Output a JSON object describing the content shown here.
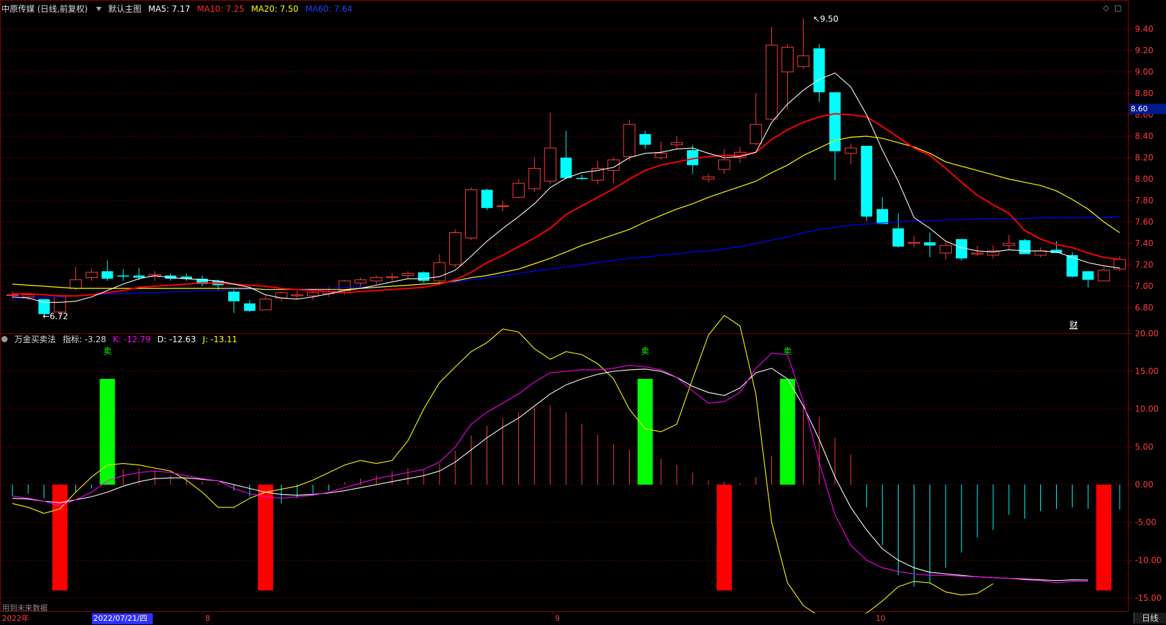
{
  "main_header": {
    "title": "中原传媒 (日线,前复权)",
    "indicator": "默认主图",
    "ma5": "MA5: 7.17",
    "ma10": "MA10: 7.25",
    "ma20": "MA20: 7.50",
    "ma60": "MA60: 7.64"
  },
  "sub_header": {
    "title": "万金买卖法",
    "indicator": "指标: -3.28",
    "k": "K: -12.79",
    "d": "D: -12.63",
    "j": "J: -13.11"
  },
  "annotations": {
    "high": "9.50",
    "low": "6.72",
    "cai": "财",
    "sell": "卖",
    "current_price": "8.60",
    "future_data": "用到未来数据"
  },
  "date_axis": {
    "year": "2022年",
    "cursor_date": "2022/07/21/四",
    "months": [
      "8",
      "9",
      "10"
    ],
    "period": "日线"
  },
  "colors": {
    "up": "#ff3b3b",
    "down": "#00ffff",
    "ma5": "#ffffff",
    "ma10": "#ff0000",
    "ma20": "#ffff00",
    "ma60": "#0000ff",
    "k": "#ff00ff",
    "d": "#ffffff",
    "j": "#ffff00",
    "buy": "#ff0000",
    "sell": "#00ff00"
  },
  "chart_data": [
    {
      "type": "candlestick",
      "title": "中原传媒 (日线,前复权)",
      "ylim": [
        6.6,
        9.5
      ],
      "y_ticks": [
        "9.40",
        "9.20",
        "9.00",
        "8.80",
        "8.60",
        "8.40",
        "8.20",
        "8.00",
        "7.80",
        "7.60",
        "7.40",
        "7.20",
        "7.00",
        "6.80"
      ],
      "candles": [
        [
          6.92,
          6.95,
          6.88,
          6.92
        ],
        [
          6.9,
          6.94,
          6.87,
          6.92
        ],
        [
          6.88,
          6.88,
          6.72,
          6.74
        ],
        [
          6.76,
          6.92,
          6.72,
          6.9
        ],
        [
          6.98,
          7.18,
          6.96,
          7.06
        ],
        [
          7.08,
          7.16,
          7.05,
          7.13
        ],
        [
          7.14,
          7.24,
          7.05,
          7.07
        ],
        [
          7.1,
          7.16,
          7.05,
          7.09
        ],
        [
          7.1,
          7.17,
          7.06,
          7.08
        ],
        [
          7.09,
          7.14,
          7.05,
          7.11
        ],
        [
          7.1,
          7.12,
          7.05,
          7.07
        ],
        [
          7.09,
          7.12,
          7.05,
          7.07
        ],
        [
          7.07,
          7.1,
          7.0,
          7.02
        ],
        [
          7.05,
          7.06,
          6.96,
          7.01
        ],
        [
          6.95,
          6.97,
          6.75,
          6.86
        ],
        [
          6.84,
          6.87,
          6.76,
          6.77
        ],
        [
          6.78,
          6.92,
          6.78,
          6.88
        ],
        [
          6.89,
          6.95,
          6.86,
          6.94
        ],
        [
          6.91,
          6.96,
          6.88,
          6.92
        ],
        [
          6.91,
          6.96,
          6.87,
          6.94
        ],
        [
          6.93,
          6.99,
          6.9,
          6.95
        ],
        [
          6.96,
          7.06,
          6.92,
          7.05
        ],
        [
          7.03,
          7.08,
          7.0,
          7.06
        ],
        [
          7.05,
          7.1,
          7.02,
          7.08
        ],
        [
          7.08,
          7.12,
          7.05,
          7.09
        ],
        [
          7.1,
          7.14,
          7.07,
          7.12
        ],
        [
          7.13,
          7.14,
          7.03,
          7.05
        ],
        [
          7.05,
          7.3,
          7.03,
          7.22
        ],
        [
          7.2,
          7.53,
          7.18,
          7.5
        ],
        [
          7.45,
          7.92,
          7.43,
          7.9
        ],
        [
          7.9,
          7.91,
          7.71,
          7.73
        ],
        [
          7.75,
          7.8,
          7.7,
          7.75
        ],
        [
          7.83,
          8.0,
          7.82,
          7.96
        ],
        [
          7.91,
          8.2,
          7.88,
          8.1
        ],
        [
          7.98,
          8.62,
          7.95,
          8.29
        ],
        [
          8.2,
          8.45,
          8.0,
          8.01
        ],
        [
          8.01,
          8.04,
          7.99,
          8.0
        ],
        [
          7.99,
          8.17,
          7.95,
          8.1
        ],
        [
          8.08,
          8.2,
          7.96,
          8.18
        ],
        [
          8.21,
          8.55,
          8.17,
          8.51
        ],
        [
          8.42,
          8.45,
          8.28,
          8.32
        ],
        [
          8.2,
          8.35,
          8.18,
          8.24
        ],
        [
          8.32,
          8.4,
          8.28,
          8.34
        ],
        [
          8.27,
          8.32,
          8.05,
          8.13
        ],
        [
          8.0,
          8.05,
          7.97,
          8.02
        ],
        [
          8.09,
          8.28,
          8.05,
          8.18
        ],
        [
          8.2,
          8.3,
          8.15,
          8.25
        ],
        [
          8.33,
          8.8,
          8.32,
          8.51
        ],
        [
          8.56,
          9.42,
          8.55,
          9.25
        ],
        [
          9.0,
          9.26,
          8.65,
          9.23
        ],
        [
          9.05,
          9.5,
          9.03,
          9.15
        ],
        [
          9.22,
          9.26,
          8.72,
          8.81
        ],
        [
          8.81,
          8.81,
          7.99,
          8.26
        ],
        [
          8.24,
          8.33,
          8.14,
          8.29
        ],
        [
          8.31,
          8.31,
          7.61,
          7.65
        ],
        [
          7.72,
          7.83,
          7.58,
          7.58
        ],
        [
          7.54,
          7.68,
          7.36,
          7.37
        ],
        [
          7.4,
          7.47,
          7.36,
          7.41
        ],
        [
          7.41,
          7.5,
          7.27,
          7.38
        ],
        [
          7.31,
          7.42,
          7.25,
          7.38
        ],
        [
          7.44,
          7.44,
          7.24,
          7.26
        ],
        [
          7.3,
          7.38,
          7.28,
          7.31
        ],
        [
          7.29,
          7.38,
          7.26,
          7.33
        ],
        [
          7.38,
          7.48,
          7.34,
          7.4
        ],
        [
          7.43,
          7.44,
          7.3,
          7.3
        ],
        [
          7.29,
          7.36,
          7.27,
          7.33
        ],
        [
          7.34,
          7.42,
          7.31,
          7.31
        ],
        [
          7.29,
          7.32,
          7.08,
          7.09
        ],
        [
          7.14,
          7.14,
          6.99,
          7.06
        ],
        [
          7.05,
          7.18,
          7.05,
          7.15
        ],
        [
          7.16,
          7.28,
          7.14,
          7.25
        ]
      ],
      "ma5": [
        6.9,
        6.89,
        6.85,
        6.85,
        6.86,
        6.9,
        6.96,
        7.02,
        7.07,
        7.1,
        7.08,
        7.07,
        7.06,
        7.05,
        7.02,
        6.99,
        6.92,
        6.89,
        6.88,
        6.9,
        6.93,
        6.96,
        6.98,
        7.01,
        7.04,
        7.07,
        7.07,
        7.09,
        7.15,
        7.28,
        7.42,
        7.54,
        7.65,
        7.77,
        7.92,
        8.01,
        8.06,
        8.08,
        8.11,
        8.2,
        8.24,
        8.25,
        8.28,
        8.29,
        8.24,
        8.2,
        8.21,
        8.25,
        8.53,
        8.7,
        8.83,
        8.93,
        8.99,
        8.86,
        8.6,
        8.27,
        7.98,
        7.64,
        7.54,
        7.42,
        7.36,
        7.33,
        7.32,
        7.34,
        7.33,
        7.33,
        7.32,
        7.27,
        7.22,
        7.19,
        7.17
      ],
      "ma10": [
        6.93,
        6.93,
        6.92,
        6.91,
        6.91,
        6.92,
        6.94,
        6.96,
        6.99,
        7.0,
        7.01,
        7.02,
        7.03,
        7.03,
        7.02,
        7.01,
        7.0,
        6.98,
        6.97,
        6.96,
        6.95,
        6.94,
        6.95,
        6.96,
        6.97,
        6.98,
        6.99,
        7.02,
        7.06,
        7.13,
        7.22,
        7.29,
        7.37,
        7.45,
        7.54,
        7.67,
        7.75,
        7.83,
        7.91,
        8.0,
        8.08,
        8.13,
        8.16,
        8.19,
        8.21,
        8.22,
        8.22,
        8.25,
        8.37,
        8.46,
        8.53,
        8.58,
        8.61,
        8.6,
        8.58,
        8.49,
        8.39,
        8.29,
        8.22,
        8.1,
        7.97,
        7.85,
        7.76,
        7.68,
        7.52,
        7.44,
        7.39,
        7.36,
        7.31,
        7.27,
        7.25
      ],
      "ma20": [
        7.02,
        7.01,
        7.0,
        6.99,
        6.98,
        6.98,
        6.98,
        6.98,
        6.98,
        6.98,
        6.98,
        6.98,
        6.98,
        6.98,
        6.98,
        6.98,
        6.97,
        6.97,
        6.97,
        6.97,
        6.97,
        6.97,
        6.98,
        6.99,
        7.0,
        7.01,
        7.02,
        7.03,
        7.05,
        7.08,
        7.1,
        7.13,
        7.16,
        7.21,
        7.26,
        7.32,
        7.38,
        7.43,
        7.48,
        7.53,
        7.6,
        7.66,
        7.72,
        7.77,
        7.83,
        7.88,
        7.93,
        7.98,
        8.06,
        8.13,
        8.22,
        8.29,
        8.36,
        8.39,
        8.4,
        8.38,
        8.34,
        8.3,
        8.24,
        8.16,
        8.12,
        8.08,
        8.04,
        8.0,
        7.97,
        7.94,
        7.89,
        7.81,
        7.72,
        7.6,
        7.5
      ],
      "ma60": [
        6.89,
        6.89,
        6.9,
        6.9,
        6.91,
        6.92,
        6.93,
        6.93,
        6.94,
        6.94,
        6.95,
        6.95,
        6.96,
        6.96,
        6.97,
        6.97,
        6.97,
        6.97,
        6.97,
        6.98,
        6.98,
        6.99,
        6.99,
        7.0,
        7.0,
        7.01,
        7.02,
        7.03,
        7.04,
        7.06,
        7.08,
        7.1,
        7.12,
        7.14,
        7.16,
        7.18,
        7.2,
        7.22,
        7.24,
        7.26,
        7.27,
        7.29,
        7.3,
        7.32,
        7.33,
        7.35,
        7.37,
        7.4,
        7.43,
        7.46,
        7.5,
        7.53,
        7.55,
        7.57,
        7.58,
        7.59,
        7.6,
        7.61,
        7.61,
        7.62,
        7.62,
        7.63,
        7.63,
        7.63,
        7.63,
        7.64,
        7.64,
        7.64,
        7.64,
        7.64,
        7.65
      ]
    },
    {
      "type": "bar+line",
      "title": "万金买卖法",
      "ylim": [
        -18,
        24
      ],
      "y_ticks": [
        "20.00",
        "15.00",
        "10.00",
        "5.00",
        "0.00",
        "-5.00",
        "-10.00",
        "-15.00"
      ],
      "indicator_hist": [
        -1.5,
        -1.2,
        -1.8,
        -2.0,
        -1.0,
        -0.5,
        1.5,
        2.0,
        2.2,
        1.8,
        1.2,
        0.8,
        0.4,
        0.2,
        -0.8,
        -1.6,
        -2.0,
        -2.5,
        -1.8,
        -1.2,
        -0.8,
        0.3,
        0.8,
        1.2,
        1.8,
        2.2,
        2.0,
        2.8,
        4.5,
        6.5,
        7.8,
        8.8,
        9.6,
        10.2,
        10.5,
        9.6,
        8.0,
        6.6,
        5.4,
        4.6,
        4.0,
        3.4,
        2.6,
        1.6,
        0.6,
        0.4,
        0.2,
        1.0,
        3.8,
        7.6,
        10.5,
        9.0,
        6.2,
        4.0,
        -3.0,
        -8.0,
        -12.0,
        -13.5,
        -13.0,
        -11.0,
        -9.0,
        -7.0,
        -6.0,
        -4.0,
        -4.5,
        -3.5,
        -3.2,
        -3.0,
        -3.2,
        -2.6,
        -3.28
      ],
      "k": [
        -1.5,
        -1.8,
        -2.2,
        -2.8,
        -2.0,
        -1.0,
        0.5,
        1.2,
        1.6,
        1.8,
        1.6,
        1.2,
        0.8,
        0.5,
        -0.5,
        -1.2,
        -1.6,
        -1.8,
        -1.6,
        -1.4,
        -1.0,
        -0.4,
        0.2,
        0.8,
        1.2,
        1.6,
        2.0,
        3.0,
        5.0,
        8.0,
        9.6,
        10.8,
        12.0,
        13.6,
        14.8,
        15.0,
        15.2,
        15.2,
        15.4,
        15.8,
        15.6,
        15.2,
        14.2,
        12.4,
        10.8,
        11.0,
        12.2,
        15.4,
        17.4,
        17.2,
        11.0,
        3.0,
        -4.0,
        -8.0,
        -10.0,
        -11.0,
        -11.5,
        -11.8,
        -12.0,
        -12.0,
        -12.1,
        -12.2,
        -12.3,
        -12.4,
        -12.6,
        -12.7,
        -13.0,
        -12.8,
        -12.79
      ],
      "d": [
        -1.8,
        -1.9,
        -2.2,
        -2.4,
        -2.0,
        -1.6,
        -1.0,
        -0.2,
        0.4,
        0.8,
        0.9,
        0.9,
        0.7,
        0.5,
        0.0,
        -0.5,
        -1.0,
        -1.3,
        -1.4,
        -1.3,
        -1.1,
        -0.8,
        -0.4,
        0.0,
        0.4,
        0.8,
        1.2,
        1.8,
        3.0,
        4.6,
        6.2,
        7.6,
        8.8,
        10.4,
        12.0,
        13.2,
        14.0,
        14.6,
        15.0,
        15.2,
        15.3,
        15.0,
        14.2,
        13.0,
        12.2,
        11.8,
        12.8,
        14.8,
        15.4,
        14.0,
        10.4,
        6.0,
        1.0,
        -3.0,
        -6.0,
        -8.5,
        -10.0,
        -11.0,
        -11.6,
        -11.8,
        -12.0,
        -12.2,
        -12.3,
        -12.4,
        -12.5,
        -12.6,
        -12.7,
        -12.6,
        -12.63
      ],
      "j": [
        -2.5,
        -3.0,
        -3.8,
        -3.2,
        -1.0,
        1.0,
        2.6,
        2.8,
        2.6,
        2.2,
        1.8,
        0.6,
        -1.0,
        -3.0,
        -3.0,
        -1.8,
        -1.0,
        -0.6,
        -0.2,
        0.6,
        1.6,
        2.6,
        3.2,
        2.8,
        3.2,
        5.8,
        10.0,
        13.5,
        15.6,
        17.6,
        18.8,
        20.6,
        20.2,
        18.0,
        16.6,
        17.6,
        17.2,
        16.0,
        14.0,
        10.0,
        7.4,
        7.0,
        8.0,
        14.0,
        19.8,
        22.4,
        21.0,
        12.0,
        -5.0,
        -13.0,
        -16.0,
        -17.4,
        -17.6,
        -17.6,
        -17.0,
        -15.4,
        -13.5,
        -12.8,
        -13.0,
        -14.2,
        -14.6,
        -14.4,
        -13.11
      ],
      "signals": [
        {
          "type": "buy",
          "x": 3
        },
        {
          "type": "sell",
          "x": 6
        },
        {
          "type": "buy",
          "x": 16
        },
        {
          "type": "sell",
          "x": 40
        },
        {
          "type": "buy",
          "x": 45
        },
        {
          "type": "sell",
          "x": 49
        },
        {
          "type": "buy",
          "x": 69
        }
      ]
    }
  ]
}
